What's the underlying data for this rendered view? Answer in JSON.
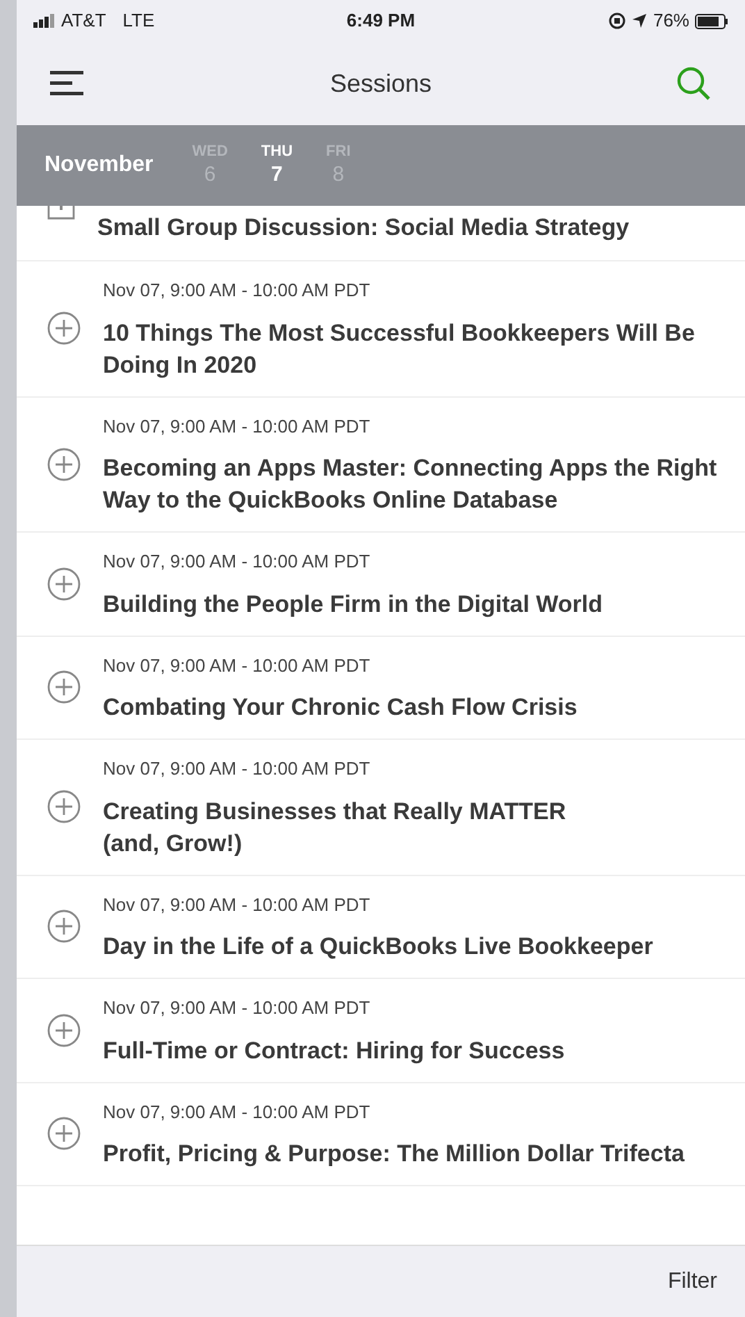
{
  "status_bar": {
    "carrier": "AT&T",
    "network": "LTE",
    "time": "6:49 PM",
    "battery": "76%"
  },
  "nav": {
    "title": "Sessions"
  },
  "date_bar": {
    "month": "November",
    "days": [
      {
        "weekday": "WED",
        "day": "6",
        "selected": false
      },
      {
        "weekday": "THU",
        "day": "7",
        "selected": true
      },
      {
        "weekday": "FRI",
        "day": "8",
        "selected": false
      }
    ]
  },
  "sessions": [
    {
      "kind": "partial",
      "title": "Small Group Discussion: Social Media Strategy"
    },
    {
      "kind": "full",
      "time": "Nov 07, 9:00 AM - 10:00 AM PDT",
      "title": "10 Things The Most Successful Bookkeepers Will Be Doing In 2020"
    },
    {
      "kind": "full",
      "time": "Nov 07, 9:00 AM - 10:00 AM PDT",
      "title": "Becoming an Apps Master: Connecting Apps the Right Way to the QuickBooks Online Database"
    },
    {
      "kind": "full",
      "time": "Nov 07, 9:00 AM - 10:00 AM PDT",
      "title": "Building the People Firm in the Digital World"
    },
    {
      "kind": "full",
      "time": "Nov 07, 9:00 AM - 10:00 AM PDT",
      "title": "Combating Your Chronic Cash Flow Crisis"
    },
    {
      "kind": "full",
      "time": "Nov 07, 9:00 AM - 10:00 AM PDT",
      "title": "Creating Businesses that Really MATTER\n(and, Grow!)"
    },
    {
      "kind": "full",
      "time": "Nov 07, 9:00 AM - 10:00 AM PDT",
      "title": "Day in the Life of a QuickBooks Live Bookkeeper"
    },
    {
      "kind": "full",
      "time": "Nov 07, 9:00 AM - 10:00 AM PDT",
      "title": "Full-Time or Contract: Hiring for Success"
    },
    {
      "kind": "full",
      "time": "Nov 07, 9:00 AM - 10:00 AM PDT",
      "title": "Profit, Pricing & Purpose: The Million Dollar Trifecta"
    }
  ],
  "footer": {
    "filter": "Filter"
  }
}
